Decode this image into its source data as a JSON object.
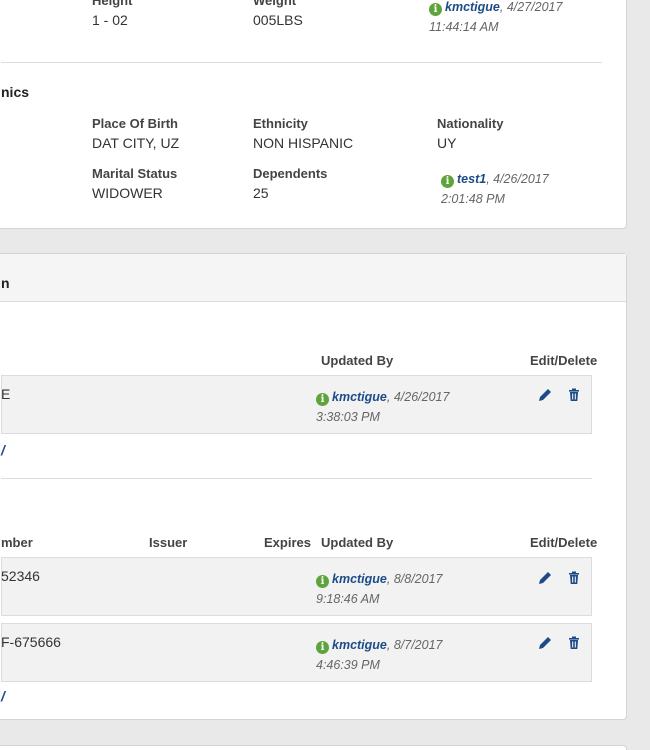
{
  "physical": {
    "height_label": "Height",
    "height_value": "1 - 02",
    "weight_label": "Weight",
    "weight_value": "005LBS",
    "updated_user": "kmctigue",
    "updated_date": ", 4/27/2017",
    "updated_time": "11:44:14 AM"
  },
  "demographics": {
    "section_title": "nics",
    "place_of_birth_label": "Place Of Birth",
    "place_of_birth_value": "DAT CITY, UZ",
    "ethnicity_label": "Ethnicity",
    "ethnicity_value": "NON HISPANIC",
    "nationality_label": "Nationality",
    "nationality_value": "UY",
    "marital_status_label": "Marital Status",
    "marital_status_value": "WIDOWER",
    "dependents_label": "Dependents",
    "dependents_value": "25",
    "updated_user": "test1",
    "updated_date": ", 4/26/2017",
    "updated_time": "2:01:48 PM"
  },
  "panel2": {
    "header_title": "n",
    "table1": {
      "col_updated_by": "Updated By",
      "col_edit_delete": "Edit/Delete",
      "rows": [
        {
          "value": "E",
          "user": "kmctigue",
          "date": ", 4/26/2017",
          "time": "3:38:03 PM"
        }
      ],
      "add_link": "/"
    },
    "table2": {
      "col_number": "mber",
      "col_issuer": "Issuer",
      "col_expires": "Expires",
      "col_updated_by": "Updated By",
      "col_edit_delete": "Edit/Delete",
      "rows": [
        {
          "number": "52346",
          "user": "kmctigue",
          "date": ", 8/8/2017",
          "time": "9:18:46 AM"
        },
        {
          "number": "F-675666",
          "user": "kmctigue",
          "date": ", 8/7/2017",
          "time": "4:46:39 PM"
        }
      ],
      "add_link": "/"
    }
  },
  "icons": {
    "info": "info-circle-icon",
    "edit": "pencil-icon",
    "delete": "trash-icon"
  },
  "colors": {
    "accent_link": "#1d4b88",
    "info_green": "#5fa33c"
  }
}
